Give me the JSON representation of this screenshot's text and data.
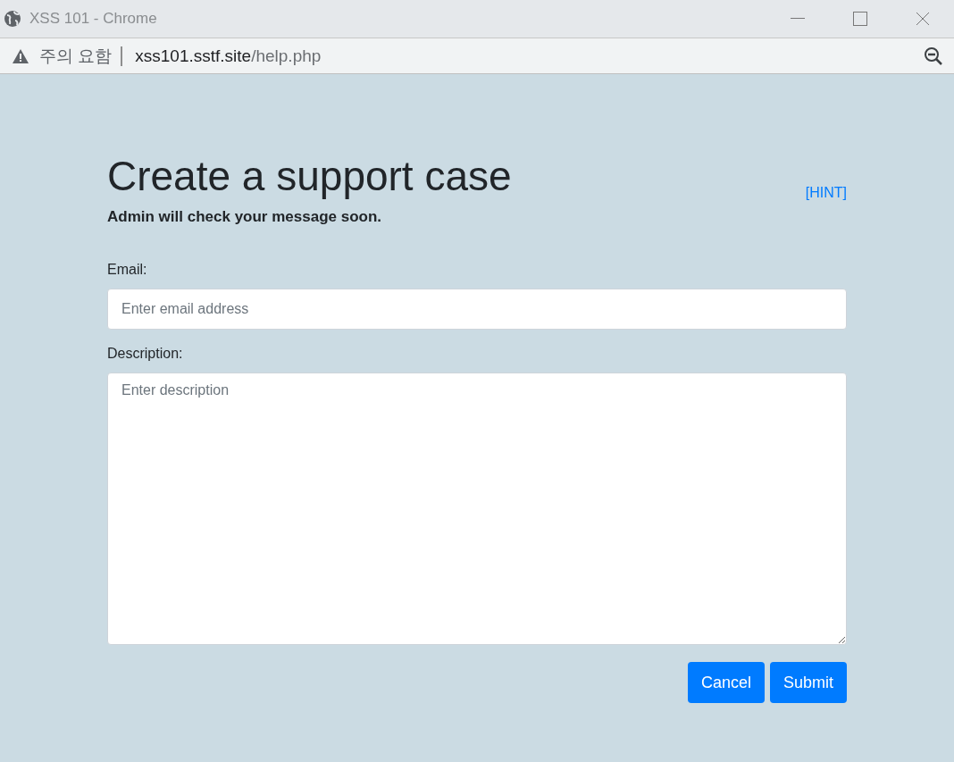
{
  "window": {
    "title": "XSS 101 - Chrome"
  },
  "address_bar": {
    "security_label": "주의 요함",
    "url_host": "xss101.sstf.site",
    "url_path": "/help.php"
  },
  "page": {
    "heading": "Create a support case",
    "hint_link": "[HINT]",
    "subtitle": "Admin will check your message soon.",
    "fields": [
      {
        "kind": "input",
        "label": "Email:",
        "placeholder": "Enter email address"
      },
      {
        "kind": "textarea",
        "label": "Description:",
        "placeholder": "Enter description"
      }
    ],
    "buttons": [
      "Cancel",
      "Submit"
    ]
  }
}
